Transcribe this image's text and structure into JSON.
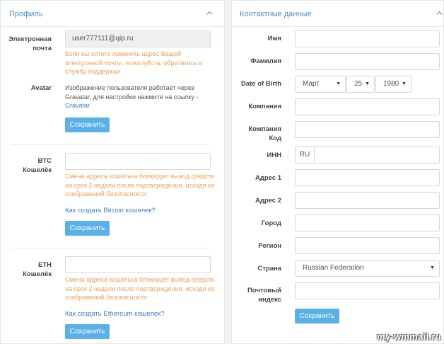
{
  "profile": {
    "title": "Профиль",
    "email_label_line1": "Электронная",
    "email_label_line2": "почта",
    "email_value": "user777111@qip.ru",
    "email_note_line1": "Если вы хотите изменить адрес Вашей",
    "email_note_line2": "электронной почты, пожалуйста, обратитесь в",
    "email_note_line3": "службу поддержки",
    "avatar_label": "Avatar",
    "avatar_text_line1": "Изображение пользователя работает через",
    "avatar_text_line2": "Gravatar, для настройки нажмите на ссылку -",
    "avatar_link": "Gravatar",
    "save_label": "Сохранить",
    "btc_label_line1": "BTC",
    "btc_label_line2": "Кошелёк",
    "btc_note_line1": "Смена адреса кошелька блокирует вывод средств",
    "btc_note_line2": "на срок 2 недели после подтверждения, исходя из",
    "btc_note_line3": "соображений безопасности",
    "btc_howto": "Как создать Bitcoin кошелек?",
    "eth_label_line1": "ETH",
    "eth_label_line2": "Кошелёк",
    "eth_note_line1": "Смена адреса кошелька блокирует вывод средств",
    "eth_note_line2": "на срок 2 недели после подтверждения, исходя из",
    "eth_note_line3": "соображений безопасности",
    "eth_howto": "Как создать Ethereum кошелек?"
  },
  "contacts": {
    "title": "Контактные данные",
    "first_name_label": "Имя",
    "last_name_label": "Фамилия",
    "dob_label": "Date of Birth",
    "dob_month": "Март",
    "dob_day": "25",
    "dob_year": "1980",
    "company_label": "Компания",
    "company_code_label_line1": "Компания",
    "company_code_label_line2": "Код",
    "inn_label": "ИНН",
    "inn_prefix": "RU",
    "address1_label": "Адрес 1",
    "address2_label": "Адрес 2",
    "city_label": "Город",
    "region_label": "Регион",
    "country_label": "Страна",
    "country_value": "Russian Federation",
    "zip_label_line1": "Почтовый",
    "zip_label_line2": "индекс",
    "save_label": "Сохранить"
  },
  "watermark": "my-wmmail.ru",
  "colors": {
    "accent": "#4a8ac9",
    "button": "#5ab0e8",
    "warning": "#f0a15b",
    "link": "#3b7fc4"
  }
}
